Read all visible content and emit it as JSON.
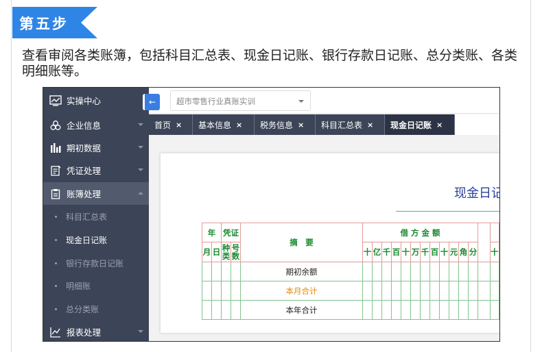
{
  "step": {
    "label": "第五步"
  },
  "description": "查看审阅各类账簿，包括科目汇总表、现金日记账、银行存款日记账、总分类账、各类明细账等。",
  "sidebar": {
    "header": "实操中心",
    "items": [
      {
        "label": "企业信息",
        "icon": "building-icon"
      },
      {
        "label": "期初数据",
        "icon": "bar-chart-icon"
      },
      {
        "label": "凭证处理",
        "icon": "voucher-icon"
      },
      {
        "label": "账簿处理",
        "icon": "ledger-icon"
      }
    ],
    "subitems": [
      "科目汇总表",
      "现金日记账",
      "银行存款日记账",
      "明细账",
      "总分类账"
    ],
    "footer": {
      "label": "报表处理",
      "icon": "line-chart-icon"
    }
  },
  "company_select": {
    "value": "超市零售行业真账实训"
  },
  "tabs": [
    {
      "label": "首页",
      "close": "×"
    },
    {
      "label": "基本信息",
      "close": "×"
    },
    {
      "label": "税务信息",
      "close": "×"
    },
    {
      "label": "科目汇总表",
      "close": "×"
    },
    {
      "label": "现金日记账",
      "close": "×"
    }
  ],
  "sheet": {
    "title_visible": "现金日记",
    "headers": {
      "year": "年",
      "voucher": "凭证",
      "summary": "摘　要",
      "debit": "借 方 金 额",
      "month": "月",
      "day": "日",
      "kind": "种类",
      "number": "号数",
      "units": [
        "十",
        "亿",
        "千",
        "百",
        "十",
        "万",
        "千",
        "百",
        "十",
        "元",
        "角",
        "分"
      ],
      "next_unit": "十"
    },
    "rows": [
      "期初余额",
      "本月合计",
      "本年合计"
    ]
  },
  "colors": {
    "accent": "#2f85e6",
    "sidebar": "#3c4457",
    "title": "#2a3f9a",
    "orange": "#e08a00",
    "green_text": "#1a8a2e"
  }
}
